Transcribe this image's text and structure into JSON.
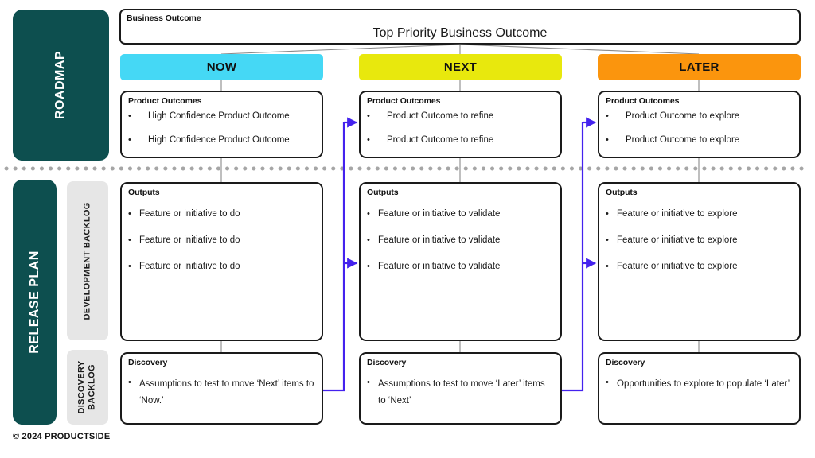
{
  "rails": {
    "roadmap": {
      "label": "ROADMAP",
      "color": "#0d4f4f"
    },
    "release_plan": {
      "label": "RELEASE PLAN",
      "color": "#0d4f4f"
    },
    "development_backlog": {
      "label": "DEVELOPMENT BACKLOG",
      "color": "#e6e6e6"
    },
    "discovery_backlog_line1": "DISCOVERY",
    "discovery_backlog_line2": "BACKLOG"
  },
  "business_outcome": {
    "label": "Business Outcome",
    "title": "Top Priority Business Outcome"
  },
  "columns": [
    {
      "key": "now",
      "header": "NOW",
      "header_color": "#45d8f5",
      "product_outcomes": {
        "title": "Product Outcomes",
        "items": [
          "High Confidence Product Outcome",
          "High Confidence Product Outcome"
        ]
      },
      "outputs": {
        "title": "Outputs",
        "items": [
          "Feature or initiative to do",
          "Feature or initiative to do",
          "Feature or initiative to do"
        ]
      },
      "discovery": {
        "title": "Discovery",
        "items": [
          "Assumptions to test to move ‘Next’ items to ‘Now.’"
        ]
      }
    },
    {
      "key": "next",
      "header": "NEXT",
      "header_color": "#e8e80d",
      "product_outcomes": {
        "title": "Product Outcomes",
        "items": [
          "Product Outcome to refine",
          "Product Outcome to refine"
        ]
      },
      "outputs": {
        "title": "Outputs",
        "items": [
          "Feature or initiative to validate",
          "Feature or initiative to validate",
          "Feature or initiative to validate"
        ]
      },
      "discovery": {
        "title": "Discovery",
        "items": [
          "Assumptions to test to move ‘Later’ items to ‘Next’"
        ]
      }
    },
    {
      "key": "later",
      "header": "LATER",
      "header_color": "#fb950d",
      "product_outcomes": {
        "title": "Product Outcomes",
        "items": [
          "Product Outcome to explore",
          "Product Outcome to explore"
        ]
      },
      "outputs": {
        "title": "Outputs",
        "items": [
          "Feature or initiative to explore",
          "Feature or initiative to explore",
          "Feature or initiative to explore"
        ]
      },
      "discovery": {
        "title": "Discovery",
        "items": [
          "Opportunities to explore to populate ‘Later’"
        ]
      }
    }
  ],
  "bullet_glyph": "•",
  "connectors": {
    "flow_color": "#4422ee",
    "tree_color": "#8a8a8a",
    "divider_color": "#a6a6a6"
  },
  "copyright": "© 2024 PRODUCTSIDE"
}
